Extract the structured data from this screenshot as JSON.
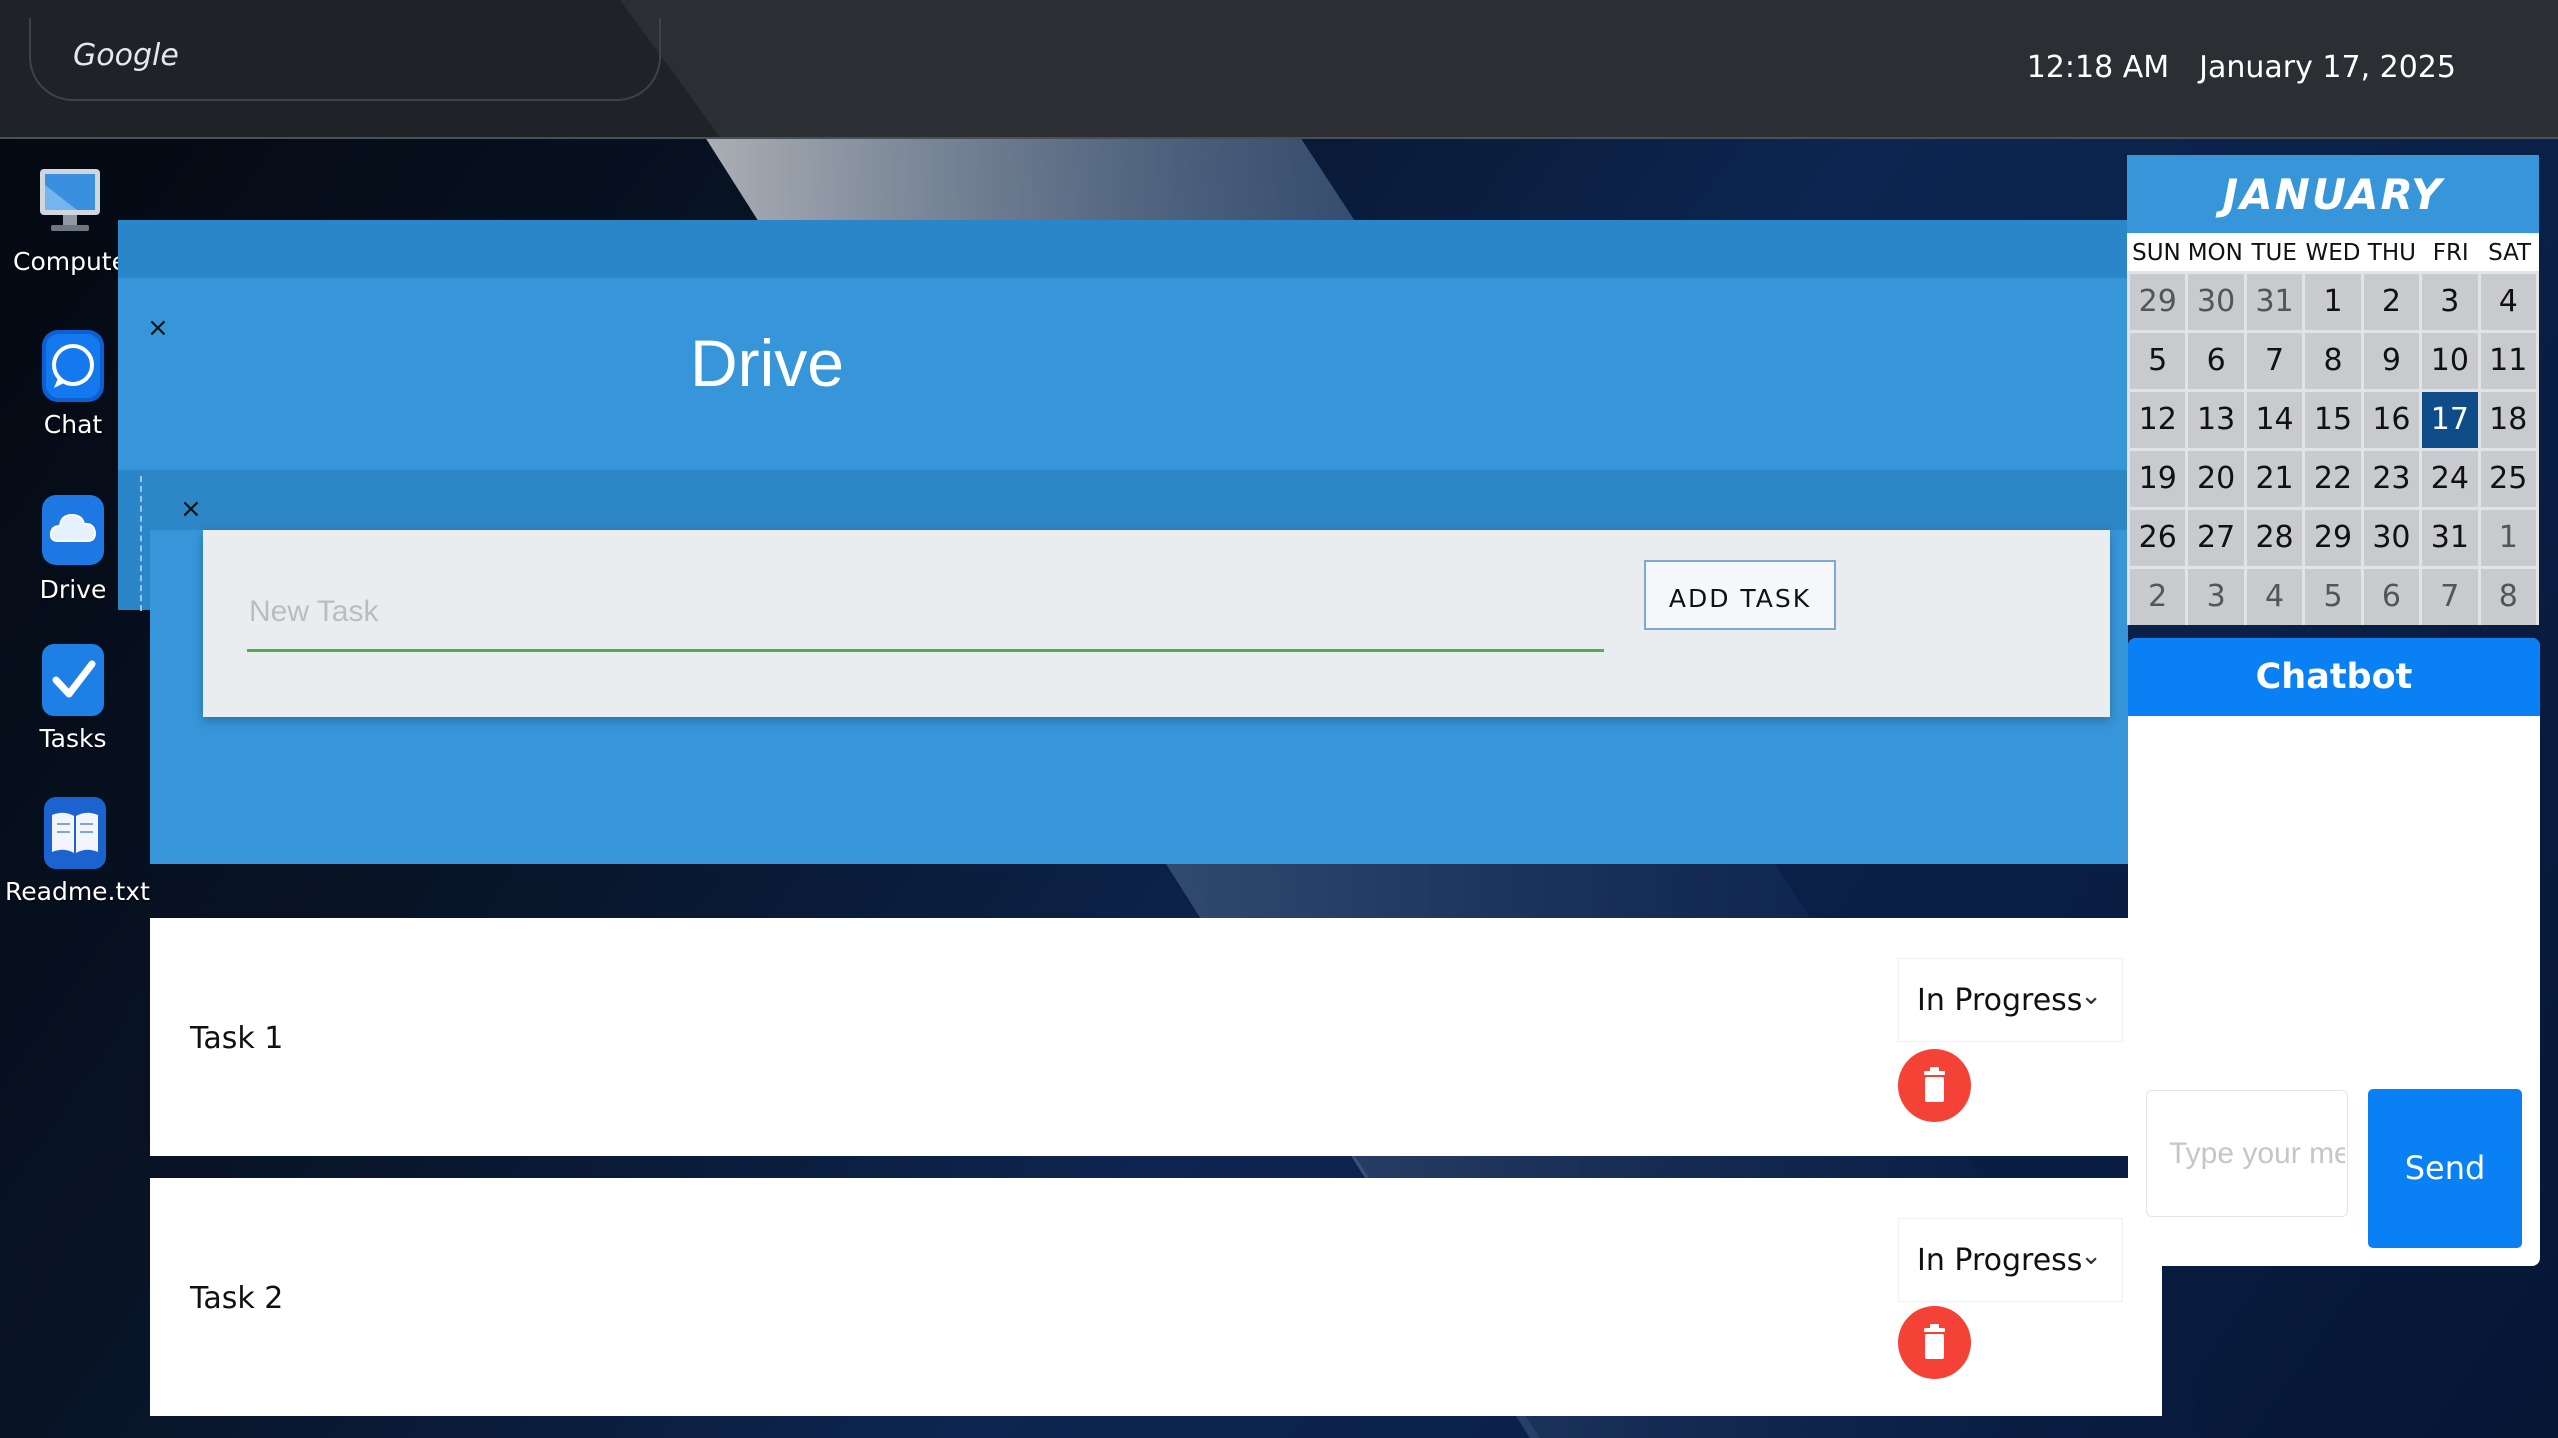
{
  "topbar": {
    "search_label": "Google",
    "time": "12:18 AM",
    "date": "January 17, 2025"
  },
  "desktop_icons": [
    {
      "label": "Compute",
      "icon": "computer-icon"
    },
    {
      "label": "Chat",
      "icon": "chat-icon"
    },
    {
      "label": "Drive",
      "icon": "cloud-icon"
    },
    {
      "label": "Tasks",
      "icon": "checkmark-icon"
    },
    {
      "label": "Readme.txt",
      "icon": "book-icon"
    }
  ],
  "drive": {
    "title": "Drive",
    "close": "×",
    "inner_close": "×",
    "new_task_placeholder": "New Task",
    "add_task_label": "ADD TASK",
    "tasks": [
      {
        "name": "Task 1",
        "status": "In Progress"
      },
      {
        "name": "Task 2",
        "status": "In Progress"
      }
    ]
  },
  "calendar": {
    "month": "JANUARY",
    "weekdays": [
      "SUN",
      "MON",
      "TUE",
      "WED",
      "THU",
      "FRI",
      "SAT"
    ],
    "weeks": [
      [
        "29",
        "30",
        "31",
        "1",
        "2",
        "3",
        "4"
      ],
      [
        "5",
        "6",
        "7",
        "8",
        "9",
        "10",
        "11"
      ],
      [
        "12",
        "13",
        "14",
        "15",
        "16",
        "17",
        "18"
      ],
      [
        "19",
        "20",
        "21",
        "22",
        "23",
        "24",
        "25"
      ],
      [
        "26",
        "27",
        "28",
        "29",
        "30",
        "31",
        "1"
      ],
      [
        "2",
        "3",
        "4",
        "5",
        "6",
        "7",
        "8"
      ]
    ],
    "today": "17"
  },
  "chatbot": {
    "title": "Chatbot",
    "input_placeholder": "Type your message...",
    "send_label": "Send"
  },
  "colors": {
    "accent": "#3796da",
    "chat_blue": "#0a80f5",
    "delete_red": "#f44336",
    "today": "#0e4d8a"
  }
}
